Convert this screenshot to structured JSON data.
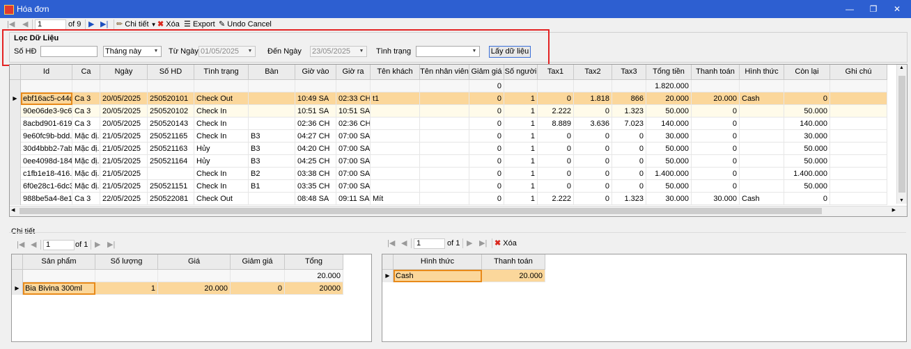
{
  "window": {
    "title": "Hóa đơn"
  },
  "toolbar": {
    "position": "1",
    "of_pages": "of 9",
    "detail_label": "Chi tiết",
    "delete_label": "Xóa",
    "export_label": "Export",
    "undo_label": "Undo Cancel"
  },
  "filter": {
    "title": "Lọc Dữ Liệu",
    "so_hd_label": "Số HĐ",
    "so_hd_value": "",
    "period_value": "Tháng này",
    "tu_ngay_label": "Từ Ngày",
    "tu_ngay_value": "01/05/2025",
    "den_ngay_label": "Đến Ngày",
    "den_ngay_value": "23/05/2025",
    "tinh_trang_label": "Tình trạng",
    "tinh_trang_value": "",
    "fetch_button": "Lấy dữ liệu"
  },
  "invoice_grid": {
    "headers": [
      "Id",
      "Ca",
      "Ngày",
      "Số HD",
      "Tình trạng",
      "Bàn",
      "Giờ vào",
      "Giờ ra",
      "Tên khách hàng",
      "Tên nhân viên",
      "Giảm giá",
      "Số người",
      "Tax1",
      "Tax2",
      "Tax3",
      "Tổng tiền",
      "Thanh toán",
      "Hình thức",
      "Còn lại",
      "Ghi chú"
    ],
    "summary": {
      "giam_gia": "0",
      "tong_tien": "1.820.000"
    },
    "rows": [
      [
        "ebf16ac5-c44c...",
        "Ca 3",
        "20/05/2025",
        "250520101",
        "Check Out",
        "",
        "10:49 SA",
        "02:33 CH",
        "t1",
        "",
        "0",
        "1",
        "0",
        "1.818",
        "866",
        "20.000",
        "20.000",
        "Cash",
        "0",
        ""
      ],
      [
        "90e06de3-9c6...",
        "Ca 3",
        "20/05/2025",
        "250520102",
        "Check In",
        "",
        "10:51 SA",
        "10:51 SA",
        "",
        "",
        "0",
        "1",
        "2.222",
        "0",
        "1.323",
        "50.000",
        "0",
        "",
        "50.000",
        ""
      ],
      [
        "8acbd901-619...",
        "Ca 3",
        "20/05/2025",
        "250520143",
        "Check In",
        "",
        "02:36 CH",
        "02:36 CH",
        "",
        "",
        "0",
        "1",
        "8.889",
        "3.636",
        "7.023",
        "140.000",
        "0",
        "",
        "140.000",
        ""
      ],
      [
        "9e60fc9b-bdd...",
        "Mặc đị...",
        "21/05/2025",
        "250521165",
        "Check In",
        "B3",
        "04:27 CH",
        "07:00 SA",
        "",
        "",
        "0",
        "1",
        "0",
        "0",
        "0",
        "30.000",
        "0",
        "",
        "30.000",
        ""
      ],
      [
        "30d4bbb2-7ab...",
        "Mặc đị...",
        "21/05/2025",
        "250521163",
        "Hủy",
        "B3",
        "04:20 CH",
        "07:00 SA",
        "",
        "",
        "0",
        "1",
        "0",
        "0",
        "0",
        "50.000",
        "0",
        "",
        "50.000",
        ""
      ],
      [
        "0ee4098d-184...",
        "Mặc đị...",
        "21/05/2025",
        "250521164",
        "Hủy",
        "B3",
        "04:25 CH",
        "07:00 SA",
        "",
        "",
        "0",
        "1",
        "0",
        "0",
        "0",
        "50.000",
        "0",
        "",
        "50.000",
        ""
      ],
      [
        "c1fb1e18-416...",
        "Mặc đị...",
        "21/05/2025",
        "",
        "Check In",
        "B2",
        "03:38 CH",
        "07:00 SA",
        "",
        "",
        "0",
        "1",
        "0",
        "0",
        "0",
        "1.400.000",
        "0",
        "",
        "1.400.000",
        ""
      ],
      [
        "6f0e28c1-6dc3...",
        "Mặc đị...",
        "21/05/2025",
        "250521151",
        "Check In",
        "B1",
        "03:35 CH",
        "07:00 SA",
        "",
        "",
        "0",
        "1",
        "0",
        "0",
        "0",
        "50.000",
        "0",
        "",
        "50.000",
        ""
      ],
      [
        "988be5a4-8e1...",
        "Ca 3",
        "22/05/2025",
        "250522081",
        "Check Out",
        "",
        "08:48 SA",
        "09:11 SA",
        "Mít",
        "",
        "0",
        "1",
        "2.222",
        "0",
        "1.323",
        "30.000",
        "30.000",
        "Cash",
        "0",
        ""
      ]
    ]
  },
  "detail": {
    "title": "Chi tiết",
    "left_nav": {
      "position": "1",
      "of_pages": "of 1"
    },
    "right_nav": {
      "position": "1",
      "of_pages": "of 1",
      "delete_label": "Xóa"
    },
    "products": {
      "headers": [
        "Sản phẩm",
        "Số lượng",
        "Giá",
        "Giảm giá",
        "Tổng"
      ],
      "summary_total": "20.000",
      "rows": [
        [
          "Bia Bivina 300ml",
          "1",
          "20.000",
          "0",
          "20000"
        ]
      ]
    },
    "payments": {
      "headers": [
        "Hình thức",
        "Thanh toán"
      ],
      "rows": [
        [
          "Cash",
          "20.000"
        ]
      ]
    }
  }
}
